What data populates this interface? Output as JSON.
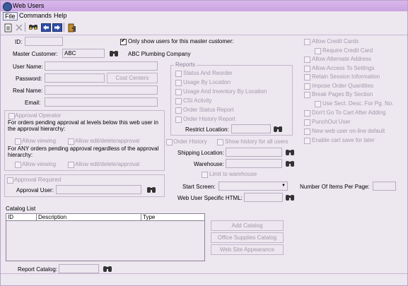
{
  "window": {
    "title": "Web Users"
  },
  "menu": {
    "file": "File",
    "commands": "Commands",
    "help": "Help"
  },
  "form": {
    "id_label": "ID:",
    "only_show_label": "Only show users for this master customer:",
    "master_customer_label": "Master Customer:",
    "master_customer_value": "ABC",
    "master_customer_name": "ABC Plumbing Company",
    "user_name_label": "User Name:",
    "password_label": "Password:",
    "cost_centers_button": "Cost Centers",
    "real_name_label": "Real Name:",
    "email_label": "Email:"
  },
  "approval": {
    "operator_label": "Approval Operator",
    "levels_text": "For orders pending approval at levels below this web user in the approval hierarchy:",
    "allow_viewing": "Allow viewing",
    "allow_edit": "Allow edit/delete/approval",
    "any_text": "For ANY orders pending approval regardless of the approval hierarchy:",
    "required_label": "Approval Required",
    "approval_user_label": "Approval User:"
  },
  "reports": {
    "legend": "Reports",
    "items": [
      "Status And Reorder",
      "Usage By Location",
      "Usage And Inventory By Location",
      "CSI Activity",
      "Order Status Report",
      "Order History Report"
    ],
    "restrict_location_label": "Restrict Location:"
  },
  "history": {
    "order_history_label": "Order History",
    "show_history_all": "Show history for all users",
    "shipping_location_label": "Shipping Location:",
    "warehouse_label": "Warehouse:",
    "limit_to_warehouse": "Limit to warehouse",
    "start_screen_label": "Start Screen:",
    "web_user_html_label": "Web User Specific HTML:",
    "items_per_page_label": "Number Of Items Per Page:"
  },
  "options": {
    "items": [
      {
        "label": "Allow Credit Cards",
        "indent": false
      },
      {
        "label": "Require Credit Card",
        "indent": true
      },
      {
        "label": "Allow Alternate Address",
        "indent": false
      },
      {
        "label": "Allow Access To Settings",
        "indent": false
      },
      {
        "label": "Retain Session Information",
        "indent": false
      },
      {
        "label": "Impose Order Quantities",
        "indent": false
      },
      {
        "label": "Break Pages By Section",
        "indent": false
      },
      {
        "label": "Use Sect. Desc. For Pg. No.",
        "indent": true
      },
      {
        "label": "Don't Go To Cart After Adding",
        "indent": false
      },
      {
        "label": "PunchOut User",
        "indent": false
      },
      {
        "label": "New web user on-line default",
        "indent": false
      },
      {
        "label": "Enable cart save for later",
        "indent": false
      }
    ]
  },
  "catalog": {
    "list_label": "Catalog List",
    "columns": [
      "ID",
      "Description",
      "Type"
    ],
    "add_catalog": "Add Catalog",
    "office_supplies": "Office Supplies Catalog",
    "web_site_appearance": "Web Site Appearance",
    "report_catalog_label": "Report Catalog:"
  }
}
